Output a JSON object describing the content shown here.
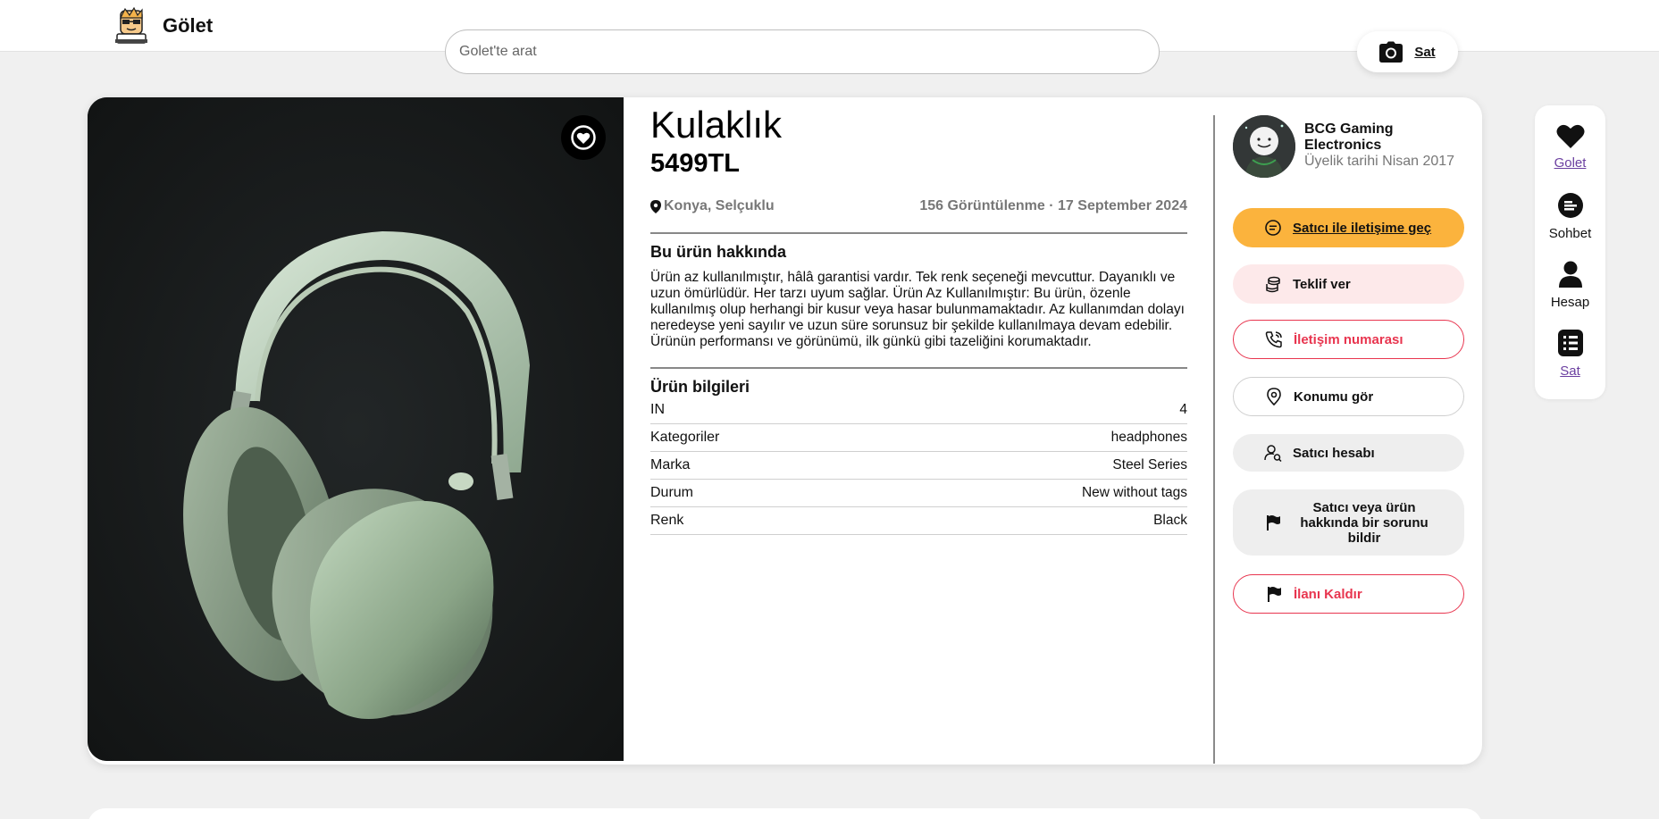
{
  "app": {
    "name": "Gölet"
  },
  "search": {
    "placeholder": "Golet'te arat"
  },
  "header": {
    "sell_label": "Sat"
  },
  "listing": {
    "title": "Kulaklık",
    "price": "5499TL",
    "location": "Konya, Selçuklu",
    "meta": "156 Görüntülenme · 17 September 2024",
    "about_heading": "Bu ürün hakkında",
    "about_text": "Ürün az kullanılmıştır, hâlâ garantisi vardır. Tek renk seçeneği mevcuttur. Dayanıklı ve uzun ömürlüdür. Her tarzı uyum sağlar. Ürün Az Kullanılmıştır: Bu ürün, özenle kullanılmış olup herhangi bir kusur veya hasar bulunmamaktadır. Az kullanımdan dolayı neredeyse yeni sayılır ve uzun süre sorunsuz bir şekilde kullanılmaya devam edebilir. Ürünün performansı ve görünümü, ilk günkü gibi tazeliğini korumaktadır.",
    "info_heading": "Ürün bilgileri",
    "specs": [
      {
        "label": "IN",
        "value": "4"
      },
      {
        "label": "Kategoriler",
        "value": "headphones"
      },
      {
        "label": "Marka",
        "value": "Steel Series"
      },
      {
        "label": "Durum",
        "value": "New without tags"
      },
      {
        "label": "Renk",
        "value": "Black"
      }
    ]
  },
  "seller": {
    "name": "BCG Gaming Electronics",
    "member_since": "Üyelik tarihi Nisan 2017"
  },
  "actions": {
    "contact": "Satıcı ile iletişime geç",
    "offer": "Teklif ver",
    "phone": "İletişim numarası",
    "location": "Konumu gör",
    "seller_account": "Satıcı hesabı",
    "report": "Satıcı veya ürün hakkında bir sorunu bildir",
    "remove": "İlanı Kaldır"
  },
  "sidebar": {
    "items": [
      {
        "label": "Golet",
        "icon": "heart-icon"
      },
      {
        "label": "Sohbet",
        "icon": "chat-icon"
      },
      {
        "label": "Hesap",
        "icon": "user-icon"
      },
      {
        "label": "Sat",
        "icon": "list-icon"
      }
    ]
  },
  "colors": {
    "accent_yellow": "#fbb33d",
    "accent_red": "#e8354f",
    "pink_bg": "#fde9ea",
    "link_purple": "#6b3fa0"
  }
}
